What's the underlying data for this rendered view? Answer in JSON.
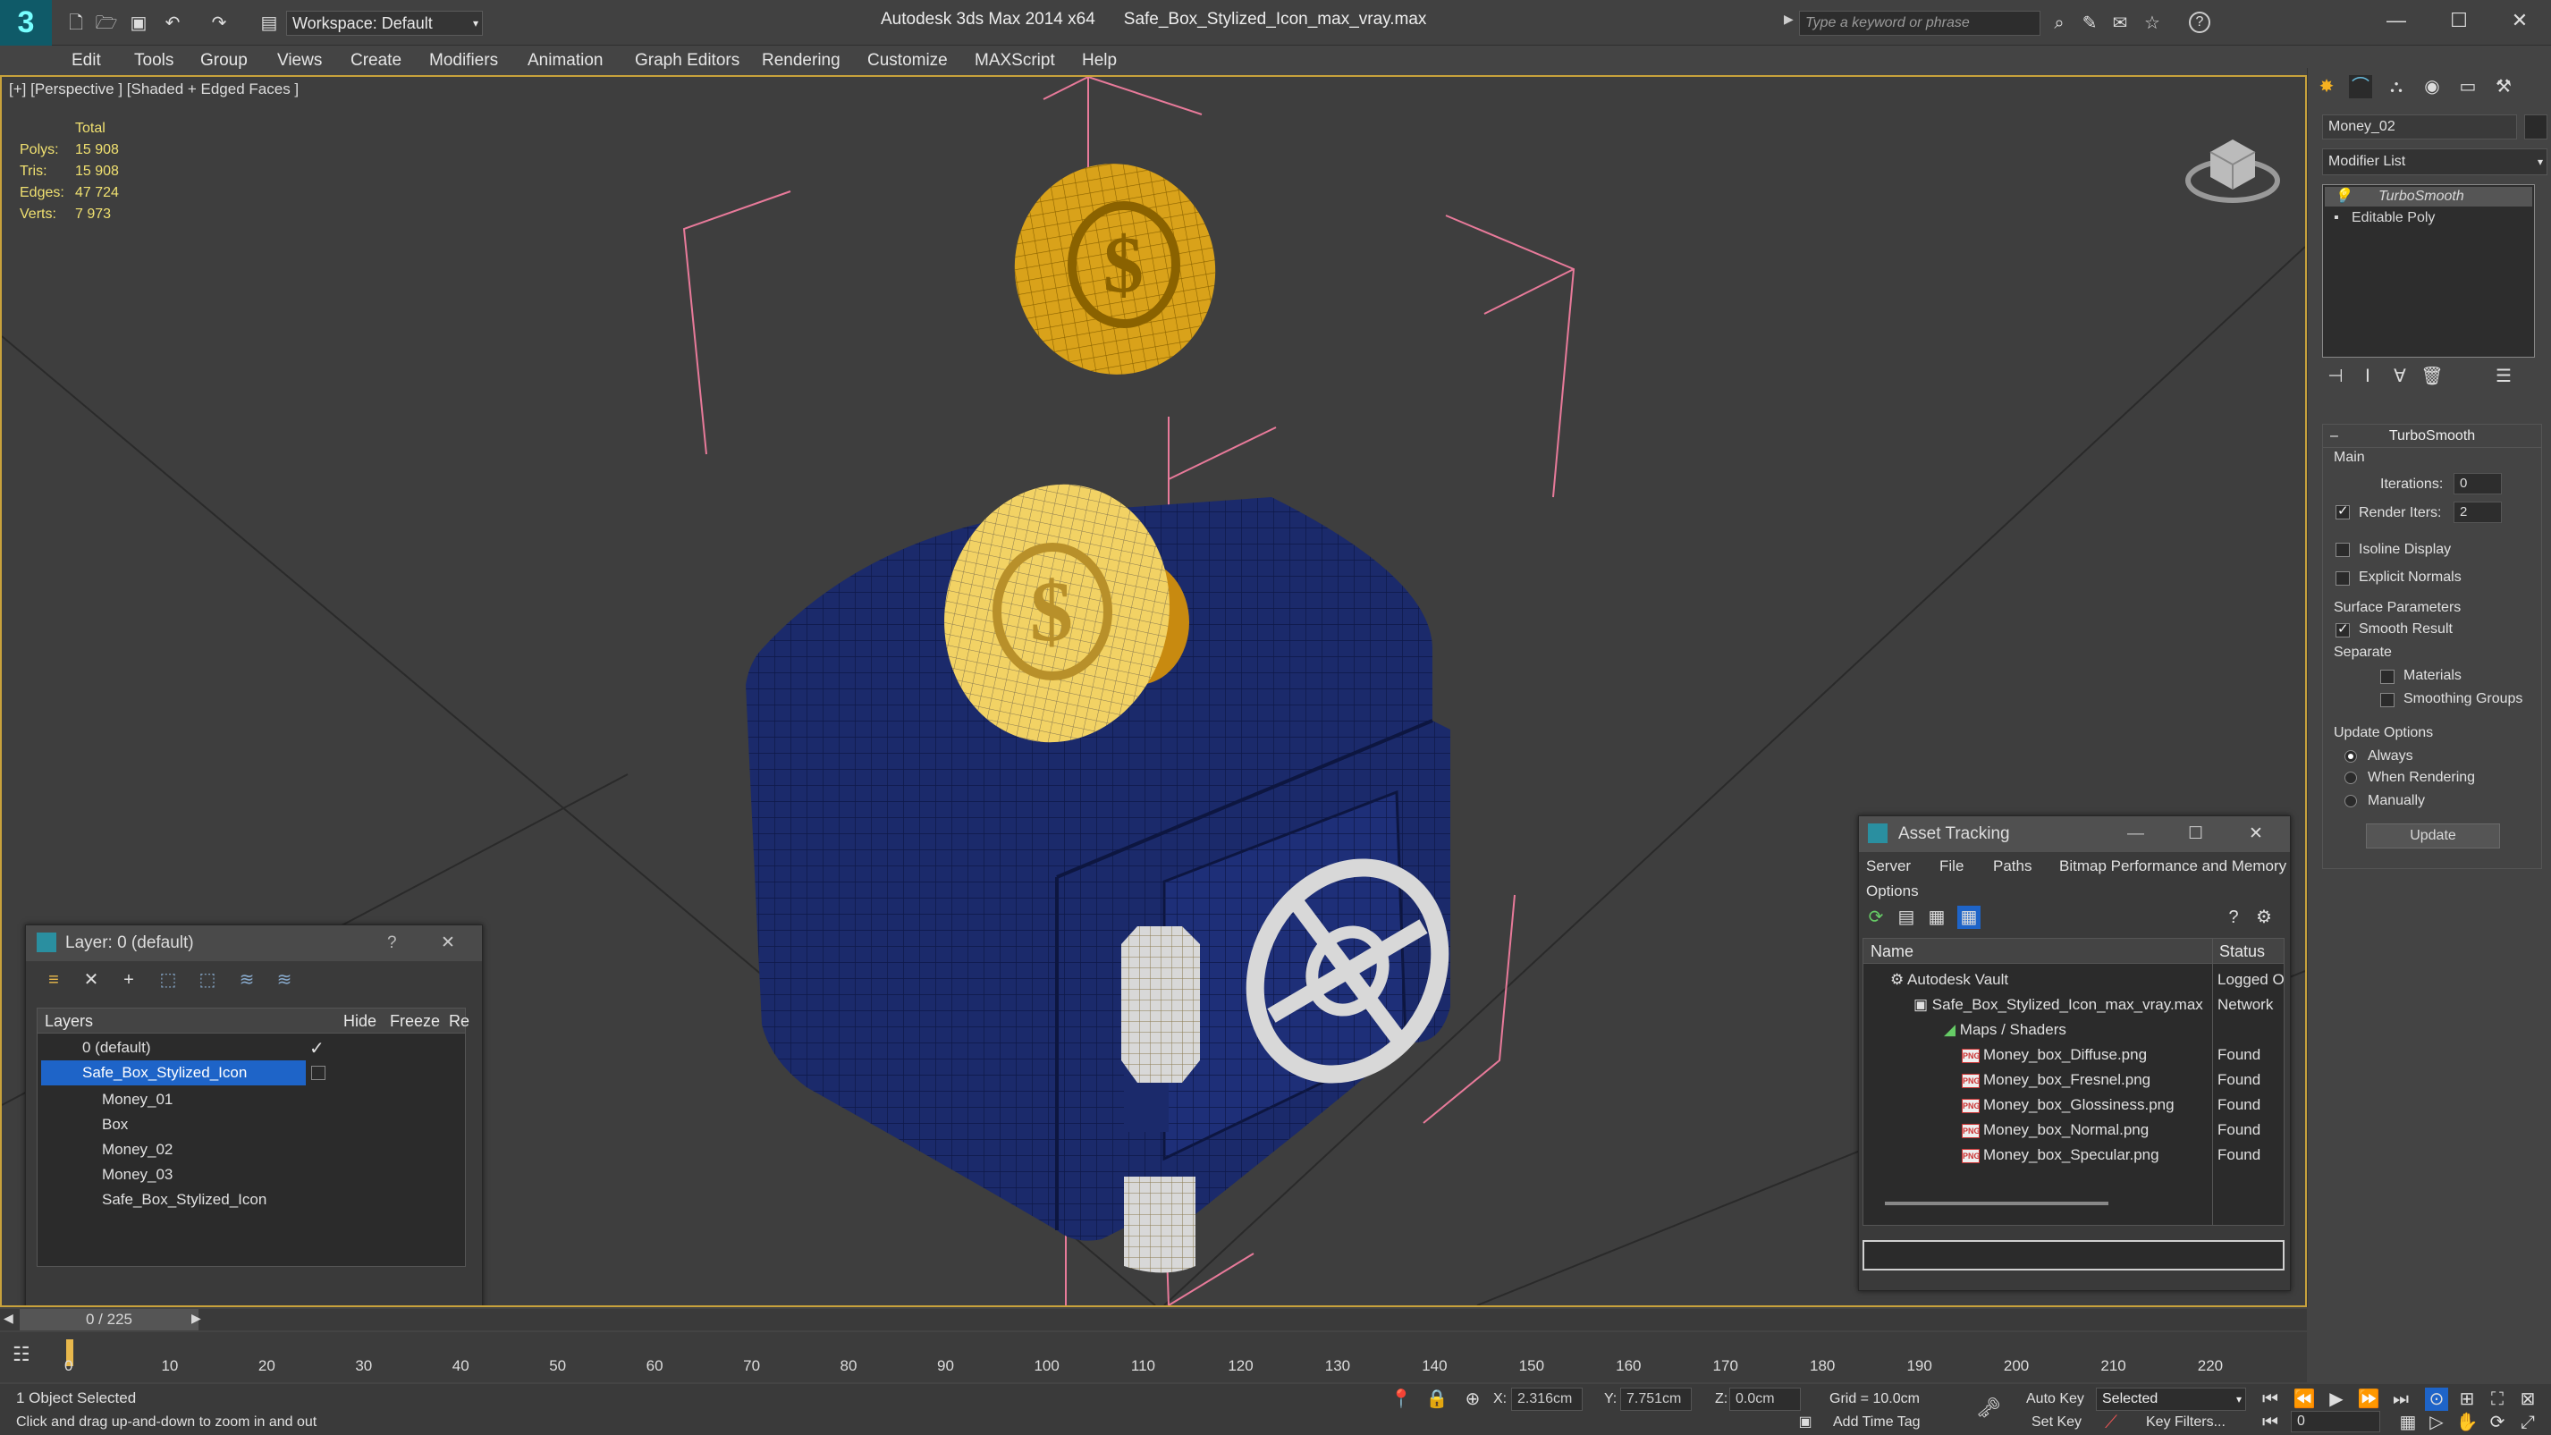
{
  "window": {
    "app_title": "Autodesk 3ds Max  2014 x64",
    "file_name": "Safe_Box_Stylized_Icon_max_vray.max",
    "workspace": "Workspace: Default",
    "search_placeholder": "Type a keyword or phrase",
    "controls": {
      "minimize": "—",
      "maximize": "☐",
      "close": "✕"
    }
  },
  "menu": [
    "Edit",
    "Tools",
    "Group",
    "Views",
    "Create",
    "Modifiers",
    "Animation",
    "Graph Editors",
    "Rendering",
    "Customize",
    "MAXScript",
    "Help"
  ],
  "viewport": {
    "label": "[+] [Perspective ] [Shaded + Edged Faces ]",
    "stats": {
      "header": "Total",
      "rows": [
        {
          "label": "Polys:",
          "value": "15 908"
        },
        {
          "label": "Tris:",
          "value": "15 908"
        },
        {
          "label": "Edges:",
          "value": "47 724"
        },
        {
          "label": "Verts:",
          "value": "7 973"
        }
      ]
    }
  },
  "command_panel": {
    "object_name": "Money_02",
    "modifier_list": "Modifier List",
    "stack": [
      "TurboSmooth",
      "Editable Poly"
    ],
    "rollout_title": "TurboSmooth",
    "main_label": "Main",
    "iterations_label": "Iterations:",
    "iterations_value": "0",
    "render_iters_label": "Render Iters:",
    "render_iters_value": "2",
    "isoline_label": "Isoline Display",
    "explicit_normals_label": "Explicit Normals",
    "surface_params_label": "Surface Parameters",
    "smooth_result_label": "Smooth Result",
    "separate_label": "Separate",
    "materials_label": "Materials",
    "smoothing_groups_label": "Smoothing Groups",
    "update_options_label": "Update Options",
    "always_label": "Always",
    "when_rendering_label": "When Rendering",
    "manually_label": "Manually",
    "update_button": "Update"
  },
  "layer_panel": {
    "title": "Layer: 0 (default)",
    "help": "?",
    "close": "✕",
    "columns": {
      "layers": "Layers",
      "hide": "Hide",
      "freeze": "Freeze",
      "render": "Re"
    },
    "rows": [
      "0 (default)",
      "Safe_Box_Stylized_Icon",
      "Money_01",
      "Box",
      "Money_02",
      "Money_03",
      "Safe_Box_Stylized_Icon"
    ]
  },
  "asset_panel": {
    "title": "Asset Tracking",
    "menu": [
      "Server",
      "File",
      "Paths",
      "Bitmap Performance and Memory",
      "Options"
    ],
    "columns": {
      "name": "Name",
      "status": "Status"
    },
    "rows": [
      {
        "name": "Autodesk Vault",
        "status": "Logged O"
      },
      {
        "name": "Safe_Box_Stylized_Icon_max_vray.max",
        "status": "Network"
      },
      {
        "name": "Maps / Shaders",
        "status": ""
      },
      {
        "name": "Money_box_Diffuse.png",
        "status": "Found"
      },
      {
        "name": "Money_box_Fresnel.png",
        "status": "Found"
      },
      {
        "name": "Money_box_Glossiness.png",
        "status": "Found"
      },
      {
        "name": "Money_box_Normal.png",
        "status": "Found"
      },
      {
        "name": "Money_box_Specular.png",
        "status": "Found"
      }
    ]
  },
  "timeline": {
    "frame_counter": "0 / 225",
    "ticks": [
      "0",
      "10",
      "20",
      "30",
      "40",
      "50",
      "60",
      "70",
      "80",
      "90",
      "100",
      "110",
      "120",
      "130",
      "140",
      "150",
      "160",
      "170",
      "180",
      "190",
      "200",
      "210",
      "220"
    ]
  },
  "status": {
    "selection": "1 Object Selected",
    "prompt": "Click and drag up-and-down to zoom in and out",
    "x_label": "X:",
    "x_value": "2.316cm",
    "y_label": "Y:",
    "y_value": "7.751cm",
    "z_label": "Z:",
    "z_value": "0.0cm",
    "grid": "Grid = 10.0cm",
    "add_time_tag": "Add Time Tag",
    "auto_key": "Auto Key",
    "set_key": "Set Key",
    "selected_dropdown": "Selected",
    "key_filters": "Key Filters...",
    "current_frame": "0"
  },
  "colors": {
    "accent": "#c8a23c",
    "selection": "#1e64c8",
    "navy": "#1b2a6b",
    "gold": "#d9a21a"
  }
}
